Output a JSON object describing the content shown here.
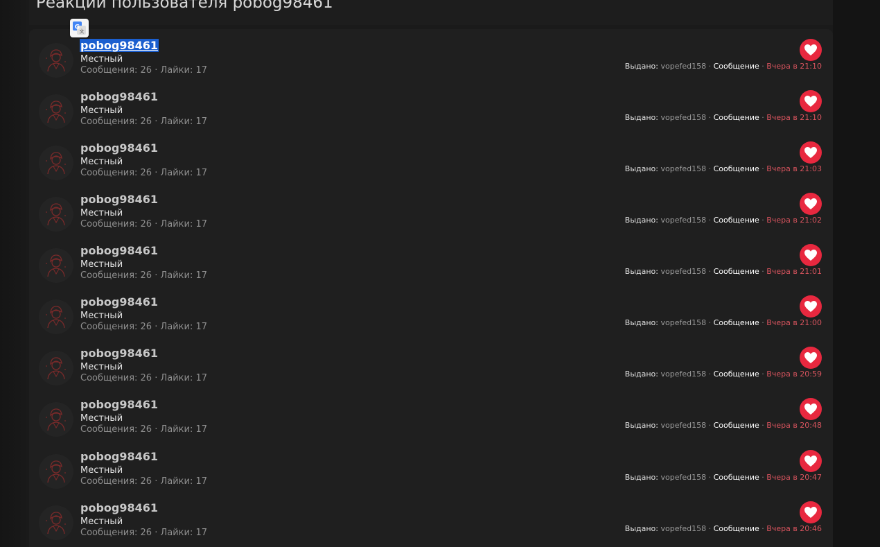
{
  "page": {
    "title": "Реакции пользователя pobog98461"
  },
  "colors": {
    "accent_red": "#e8283f",
    "time_red": "#d8545e",
    "selection_blue": "#1b5fcf"
  },
  "icons": {
    "avatar": "person-avatar-icon",
    "reaction": "heart-icon",
    "translate": "google-translate-icon"
  },
  "labels": {
    "given_by": "Выдано:",
    "separator": "·",
    "content_type": "Сообщение"
  },
  "rows": [
    {
      "username": "pobog98461",
      "user_title": "Местный",
      "stats": "Сообщения: 26 · Лайки: 17",
      "giver": "vopefed158",
      "time": "Вчера в 21:10"
    },
    {
      "username": "pobog98461",
      "user_title": "Местный",
      "stats": "Сообщения: 26 · Лайки: 17",
      "giver": "vopefed158",
      "time": "Вчера в 21:10"
    },
    {
      "username": "pobog98461",
      "user_title": "Местный",
      "stats": "Сообщения: 26 · Лайки: 17",
      "giver": "vopefed158",
      "time": "Вчера в 21:03"
    },
    {
      "username": "pobog98461",
      "user_title": "Местный",
      "stats": "Сообщения: 26 · Лайки: 17",
      "giver": "vopefed158",
      "time": "Вчера в 21:02"
    },
    {
      "username": "pobog98461",
      "user_title": "Местный",
      "stats": "Сообщения: 26 · Лайки: 17",
      "giver": "vopefed158",
      "time": "Вчера в 21:01"
    },
    {
      "username": "pobog98461",
      "user_title": "Местный",
      "stats": "Сообщения: 26 · Лайки: 17",
      "giver": "vopefed158",
      "time": "Вчера в 21:00"
    },
    {
      "username": "pobog98461",
      "user_title": "Местный",
      "stats": "Сообщения: 26 · Лайки: 17",
      "giver": "vopefed158",
      "time": "Вчера в 20:59"
    },
    {
      "username": "pobog98461",
      "user_title": "Местный",
      "stats": "Сообщения: 26 · Лайки: 17",
      "giver": "vopefed158",
      "time": "Вчера в 20:48"
    },
    {
      "username": "pobog98461",
      "user_title": "Местный",
      "stats": "Сообщения: 26 · Лайки: 17",
      "giver": "vopefed158",
      "time": "Вчера в 20:47"
    },
    {
      "username": "pobog98461",
      "user_title": "Местный",
      "stats": "Сообщения: 26 · Лайки: 17",
      "giver": "vopefed158",
      "time": "Вчера в 20:46"
    }
  ]
}
